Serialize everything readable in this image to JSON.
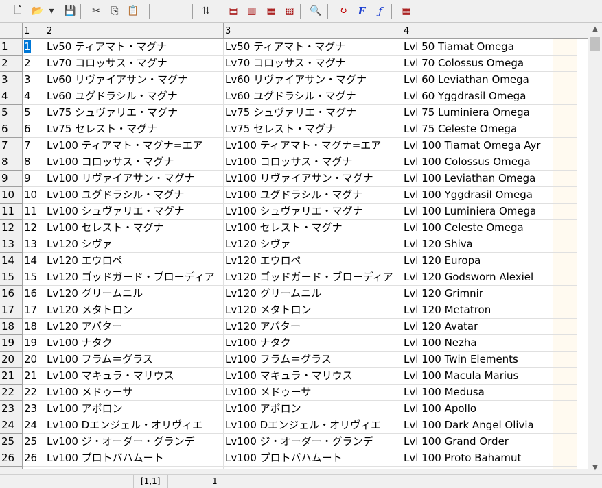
{
  "toolbar": {
    "buttons": [
      {
        "name": "new-document-icon",
        "glyph": "🗋"
      },
      {
        "name": "open-folder-icon",
        "glyph": "📂"
      },
      {
        "name": "dropdown-arrow-icon",
        "glyph": "▾"
      },
      {
        "name": "save-disk-icon",
        "glyph": "💾"
      },
      {
        "name": "cut-icon",
        "glyph": "✂"
      },
      {
        "name": "copy-icon",
        "glyph": "⎘"
      },
      {
        "name": "paste-icon",
        "glyph": "📋"
      },
      {
        "name": "sort-icon",
        "glyph": "⇅"
      },
      {
        "name": "insert-row-icon",
        "glyph": "▤"
      },
      {
        "name": "insert-column-icon",
        "glyph": "▥"
      },
      {
        "name": "delete-row-icon",
        "glyph": "▦"
      },
      {
        "name": "delete-column-icon",
        "glyph": "▧"
      },
      {
        "name": "find-icon",
        "glyph": "🔍"
      },
      {
        "name": "refresh-icon",
        "glyph": "↻"
      },
      {
        "name": "font-icon",
        "glyph": "F"
      },
      {
        "name": "function-icon",
        "glyph": "ƒ"
      },
      {
        "name": "grid-table-icon",
        "glyph": "▦"
      }
    ]
  },
  "columns": [
    "",
    "1",
    "2",
    "3",
    "4"
  ],
  "rows": [
    {
      "num": "1",
      "c1": "1",
      "c2": "Lv50 ティアマト・マグナ",
      "c3": "Lv50 ティアマト・マグナ",
      "c4": "Lvl 50 Tiamat Omega"
    },
    {
      "num": "2",
      "c1": "2",
      "c2": "Lv70 コロッサス・マグナ",
      "c3": "Lv70 コロッサス・マグナ",
      "c4": "Lvl 70 Colossus Omega"
    },
    {
      "num": "3",
      "c1": "3",
      "c2": "Lv60 リヴァイアサン・マグナ",
      "c3": "Lv60 リヴァイアサン・マグナ",
      "c4": "Lvl 60 Leviathan Omega"
    },
    {
      "num": "4",
      "c1": "4",
      "c2": "Lv60 ユグドラシル・マグナ",
      "c3": "Lv60 ユグドラシル・マグナ",
      "c4": "Lvl 60 Yggdrasil Omega"
    },
    {
      "num": "5",
      "c1": "5",
      "c2": "Lv75 シュヴァリエ・マグナ",
      "c3": "Lv75 シュヴァリエ・マグナ",
      "c4": "Lvl 75 Luminiera Omega"
    },
    {
      "num": "6",
      "c1": "6",
      "c2": "Lv75 セレスト・マグナ",
      "c3": "Lv75 セレスト・マグナ",
      "c4": "Lvl 75 Celeste Omega"
    },
    {
      "num": "7",
      "c1": "7",
      "c2": "Lv100 ティアマト・マグナ=エア",
      "c3": "Lv100 ティアマト・マグナ=エア",
      "c4": "Lvl 100 Tiamat Omega Ayr"
    },
    {
      "num": "8",
      "c1": "8",
      "c2": "Lv100 コロッサス・マグナ",
      "c3": "Lv100 コロッサス・マグナ",
      "c4": "Lvl 100 Colossus Omega"
    },
    {
      "num": "9",
      "c1": "9",
      "c2": "Lv100 リヴァイアサン・マグナ",
      "c3": "Lv100 リヴァイアサン・マグナ",
      "c4": "Lvl 100 Leviathan Omega"
    },
    {
      "num": "10",
      "c1": "10",
      "c2": "Lv100 ユグドラシル・マグナ",
      "c3": "Lv100 ユグドラシル・マグナ",
      "c4": "Lvl 100 Yggdrasil Omega"
    },
    {
      "num": "11",
      "c1": "11",
      "c2": "Lv100 シュヴァリエ・マグナ",
      "c3": "Lv100 シュヴァリエ・マグナ",
      "c4": "Lvl 100 Luminiera Omega"
    },
    {
      "num": "12",
      "c1": "12",
      "c2": "Lv100 セレスト・マグナ",
      "c3": "Lv100 セレスト・マグナ",
      "c4": "Lvl 100 Celeste Omega"
    },
    {
      "num": "13",
      "c1": "13",
      "c2": "Lv120 シヴァ",
      "c3": "Lv120 シヴァ",
      "c4": "Lvl 120 Shiva"
    },
    {
      "num": "14",
      "c1": "14",
      "c2": "Lv120 エウロペ",
      "c3": "Lv120 エウロペ",
      "c4": "Lvl 120 Europa"
    },
    {
      "num": "15",
      "c1": "15",
      "c2": "Lv120 ゴッドガード・ブローディア",
      "c3": "Lv120 ゴッドガード・ブローディア",
      "c4": "Lvl 120 Godsworn Alexiel"
    },
    {
      "num": "16",
      "c1": "16",
      "c2": "Lv120 グリームニル",
      "c3": "Lv120 グリームニル",
      "c4": "Lvl 120 Grimnir"
    },
    {
      "num": "17",
      "c1": "17",
      "c2": "Lv120 メタトロン",
      "c3": "Lv120 メタトロン",
      "c4": "Lvl 120 Metatron"
    },
    {
      "num": "18",
      "c1": "18",
      "c2": "Lv120 アバター",
      "c3": "Lv120 アバター",
      "c4": "Lvl 120 Avatar"
    },
    {
      "num": "19",
      "c1": "19",
      "c2": "Lv100 ナタク",
      "c3": "Lv100 ナタク",
      "c4": "Lvl 100 Nezha"
    },
    {
      "num": "20",
      "c1": "20",
      "c2": "Lv100 フラム＝グラス",
      "c3": "Lv100 フラム＝グラス",
      "c4": "Lvl 100 Twin Elements"
    },
    {
      "num": "21",
      "c1": "21",
      "c2": "Lv100 マキュラ・マリウス",
      "c3": "Lv100 マキュラ・マリウス",
      "c4": "Lvl 100 Macula Marius"
    },
    {
      "num": "22",
      "c1": "22",
      "c2": "Lv100 メドゥーサ",
      "c3": "Lv100 メドゥーサ",
      "c4": "Lvl 100 Medusa"
    },
    {
      "num": "23",
      "c1": "23",
      "c2": "Lv100 アポロン",
      "c3": "Lv100 アポロン",
      "c4": "Lvl 100 Apollo"
    },
    {
      "num": "24",
      "c1": "24",
      "c2": "Lv100 Dエンジェル・オリヴィエ",
      "c3": "Lv100 Dエンジェル・オリヴィエ",
      "c4": "Lvl 100 Dark Angel Olivia"
    },
    {
      "num": "25",
      "c1": "25",
      "c2": "Lv100 ジ・オーダー・グランデ",
      "c3": "Lv100 ジ・オーダー・グランデ",
      "c4": "Lvl 100 Grand Order"
    },
    {
      "num": "26",
      "c1": "26",
      "c2": "Lv100 プロトバハムート",
      "c3": "Lv100 プロトバハムート",
      "c4": "Lvl 100 Proto Bahamut"
    }
  ],
  "status": {
    "position": "[1,1]",
    "value": "1"
  },
  "colors": {
    "selection": "#0078d7",
    "header_bg": "#f0f0f0",
    "filler_bg": "#fffaf0"
  }
}
